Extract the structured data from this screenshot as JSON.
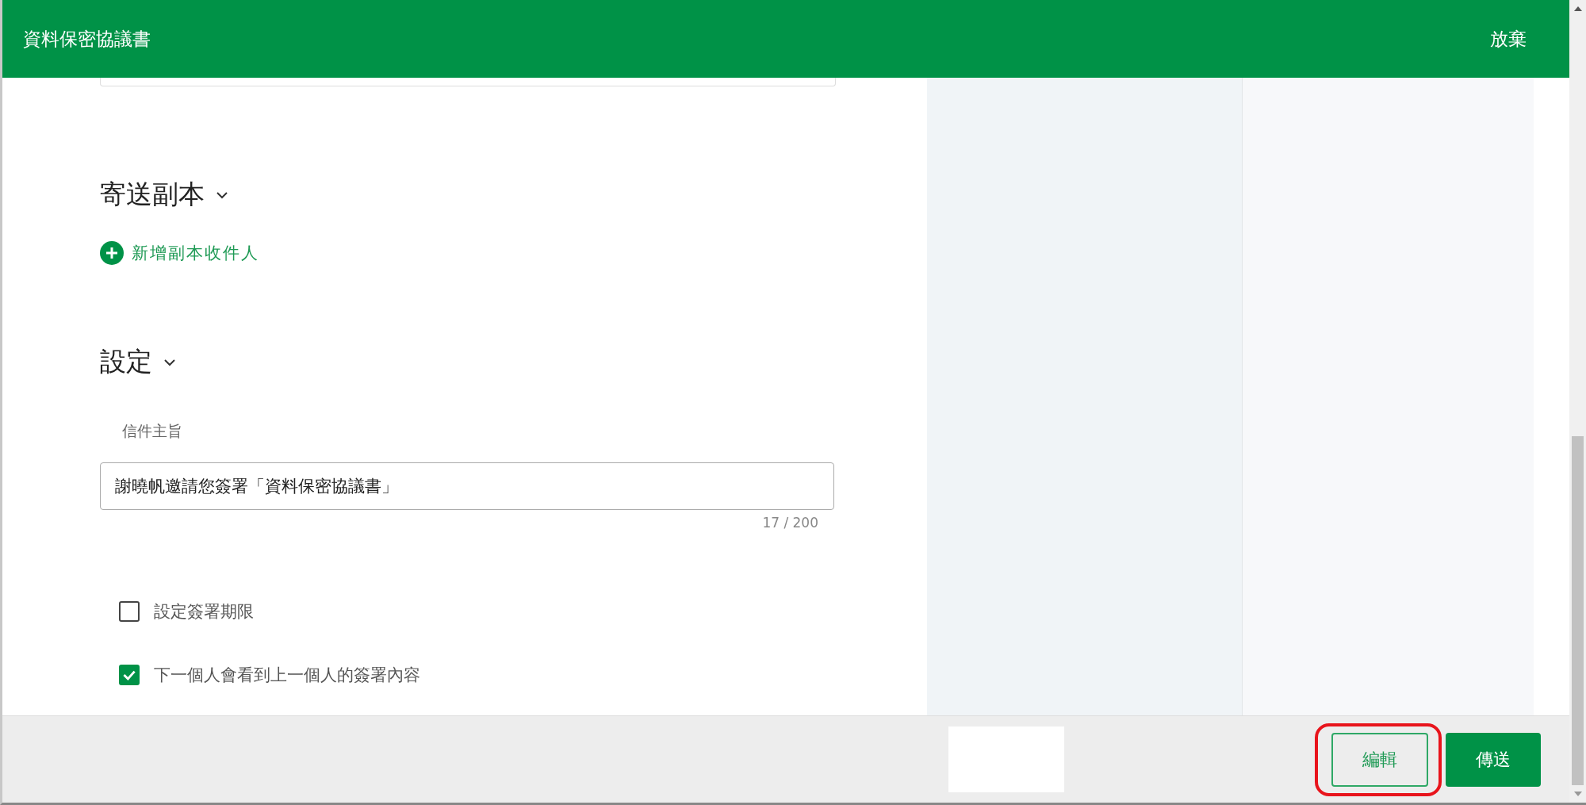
{
  "header": {
    "title": "資料保密協議書",
    "discard": "放棄"
  },
  "cc_section": {
    "title": "寄送副本",
    "expanded": true,
    "add_link": "新增副本收件人"
  },
  "settings_section": {
    "title": "設定",
    "expanded": true,
    "subject_label": "信件主旨",
    "subject_value": "謝曉帆邀請您簽署「資料保密協議書」",
    "counter": "17 / 200",
    "options": [
      {
        "label": "設定簽署期限",
        "checked": false
      },
      {
        "label": "下一個人會看到上一個人的簽署內容",
        "checked": true
      }
    ]
  },
  "footer": {
    "buttons": [
      {
        "label": "編輯",
        "kind": "outline",
        "highlighted": true
      },
      {
        "label": "傳送",
        "kind": "primary",
        "highlighted": false
      }
    ]
  }
}
